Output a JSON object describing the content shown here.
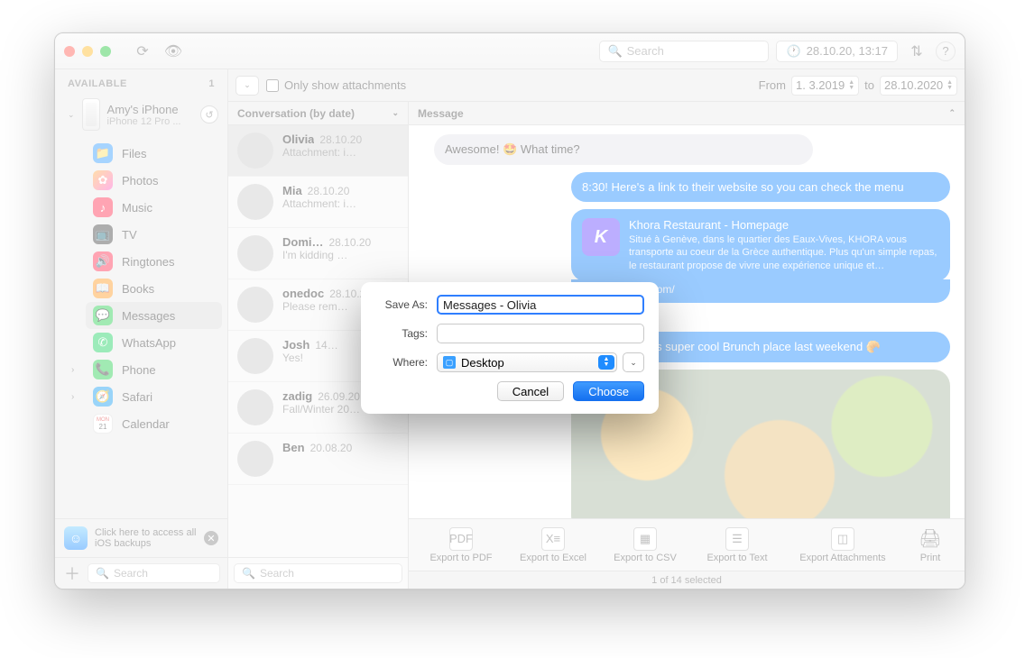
{
  "titlebar": {
    "search_placeholder": "Search",
    "date": "28.10.20, 13:17"
  },
  "sidebar": {
    "header": "AVAILABLE",
    "count": "1",
    "device": {
      "name": "Amy's iPhone",
      "model": "iPhone 12 Pro ..."
    },
    "items": [
      {
        "label": "Files"
      },
      {
        "label": "Photos"
      },
      {
        "label": "Music"
      },
      {
        "label": "TV"
      },
      {
        "label": "Ringtones"
      },
      {
        "label": "Books"
      },
      {
        "label": "Messages"
      },
      {
        "label": "WhatsApp"
      },
      {
        "label": "Phone"
      },
      {
        "label": "Safari"
      },
      {
        "label": "Calendar"
      }
    ],
    "banner": "Click here to access all iOS backups",
    "search_placeholder": "Search"
  },
  "filter": {
    "checkbox_label": "Only show attachments",
    "from_label": "From",
    "from_value": "1.  3.2019",
    "to_label": "to",
    "to_value": "28.10.2020"
  },
  "midheader": "Conversation (by date)",
  "conversations": [
    {
      "name": "Olivia",
      "date": "28.10.20",
      "preview": "Attachment: i…"
    },
    {
      "name": "Mia",
      "date": "28.10.20",
      "preview": "Attachment: i…"
    },
    {
      "name": "Domi…",
      "date": "28.10.20",
      "preview": "I'm kidding …"
    },
    {
      "name": "onedoc",
      "date": "28.10.20",
      "preview": "Please rem…"
    },
    {
      "name": "Josh",
      "date": "14…",
      "preview": "Yes!"
    },
    {
      "name": "zadig",
      "date": "26.09.20",
      "preview": "Fall/Winter 20…"
    },
    {
      "name": "Ben",
      "date": "20.08.20",
      "preview": ""
    }
  ],
  "mid_search_placeholder": "Search",
  "msgheader": "Message",
  "bubbles": {
    "b1": "Awesome! 🤩 What time?",
    "b2": "8:30! Here's a link to their website so you can check the menu",
    "link_title": "Khora Restaurant - Homepage",
    "link_desc": "Situé à Genève, dans le quartier des Eaux-Vives, KHORA vous transporte au coeur de la Grèce authentique. Plus qu'un simple repas, le restaurant propose de vivre une expérience unique et…",
    "link_url": "khora-geneve.com/",
    "b3": "We went to this super cool Brunch place last weekend 🥐"
  },
  "export": {
    "pdf": "Export to PDF",
    "xls": "Export to Excel",
    "csv": "Export to CSV",
    "txt": "Export to Text",
    "att": "Export Attachments",
    "print": "Print"
  },
  "status": "1 of 14 selected",
  "sheet": {
    "saveas_label": "Save As:",
    "saveas_value": "Messages - Olivia",
    "tags_label": "Tags:",
    "where_label": "Where:",
    "where_value": "Desktop",
    "cancel": "Cancel",
    "choose": "Choose"
  }
}
